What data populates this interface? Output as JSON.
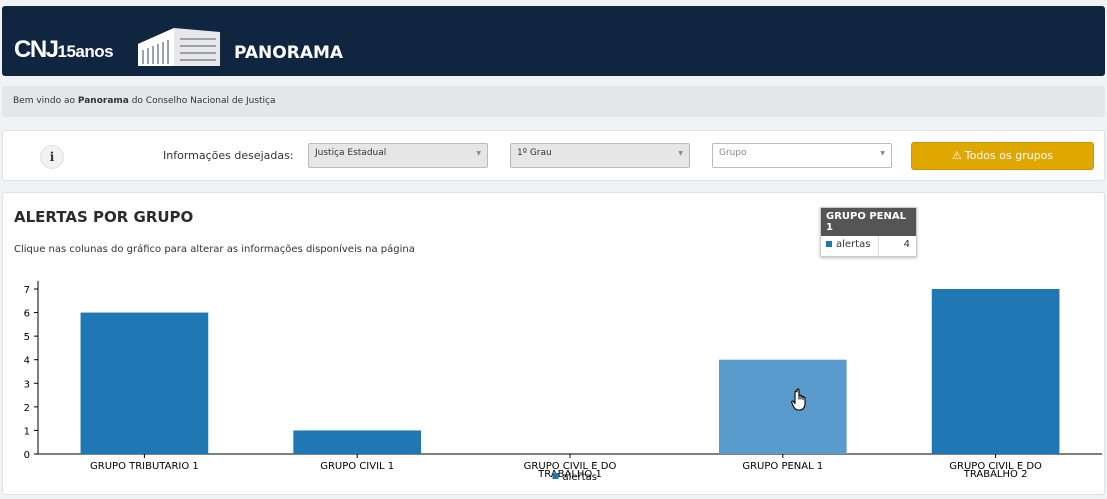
{
  "header": {
    "logo_main": "CNJ",
    "logo_years": "15anos",
    "title": "PANORAMA"
  },
  "welcome": {
    "prefix": "Bem vindo ao",
    "app": "Panorama",
    "suffix": "do Conselho Nacional de Justiça"
  },
  "filters": {
    "label": "Informações desejadas:",
    "justice": "Justiça Estadual",
    "degree": "1º Grau",
    "group_placeholder": "Grupo",
    "all_groups_button": "Todos os grupos"
  },
  "panel": {
    "title": "ALERTAS POR GRUPO",
    "subtitle": "Clique nas colunas do gráfico para alterar as informações disponíveis na página"
  },
  "chart_data": {
    "type": "bar",
    "categories": [
      "GRUPO TRIBUTARIO 1",
      "GRUPO CIVIL 1",
      "GRUPO CIVIL E DO TRABALHO 1",
      "GRUPO PENAL 1",
      "GRUPO CIVIL E DO TRABALHO 2"
    ],
    "category_lines": [
      [
        "GRUPO TRIBUTARIO 1"
      ],
      [
        "GRUPO CIVIL 1"
      ],
      [
        "GRUPO CIVIL E DO",
        "TRABALHO 1"
      ],
      [
        "GRUPO PENAL 1"
      ],
      [
        "GRUPO CIVIL E DO",
        "TRABALHO 2"
      ]
    ],
    "series": [
      {
        "name": "alertas",
        "values": [
          6,
          1,
          0,
          4,
          7
        ]
      }
    ],
    "ylim": [
      0,
      7
    ],
    "yticks": [
      "0",
      "1",
      "2",
      "3",
      "4",
      "5",
      "6",
      "7"
    ],
    "highlighted_index": 3,
    "colors": {
      "bar": "#1f77b4",
      "bar_highlight": "#5a9bcd"
    },
    "legend": "bottom-center"
  },
  "tooltip": {
    "title": "GRUPO PENAL 1",
    "series": "alertas",
    "value": "4"
  }
}
